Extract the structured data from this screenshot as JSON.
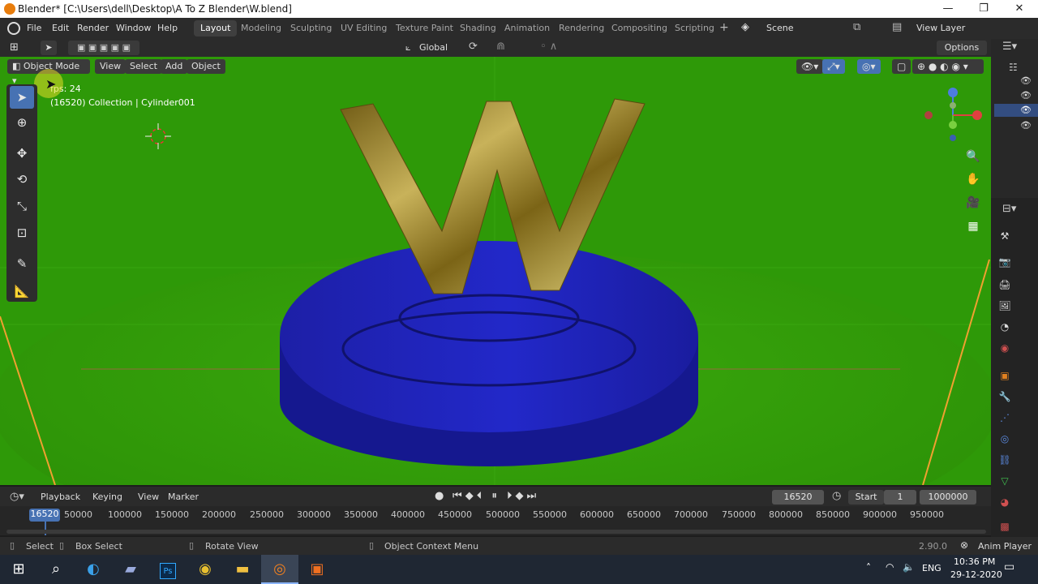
{
  "window": {
    "title": "Blender* [C:\\Users\\dell\\Desktop\\A To Z Blender\\W.blend]",
    "minimize": "—",
    "maximize": "❐",
    "close": "✕"
  },
  "menus": [
    "File",
    "Edit",
    "Render",
    "Window",
    "Help"
  ],
  "workspaces": [
    "Layout",
    "Modeling",
    "Sculpting",
    "UV Editing",
    "Texture Paint",
    "Shading",
    "Animation",
    "Rendering",
    "Compositing",
    "Scripting"
  ],
  "scene": {
    "name": "Scene",
    "view_layer": "View Layer"
  },
  "toolrow": {
    "orientation": "Global",
    "options": "Options"
  },
  "viewport": {
    "mode": "Object Mode",
    "menus": [
      "View",
      "Select",
      "Add",
      "Object"
    ],
    "fps_text": "fps: 24",
    "info": "(16520) Collection | Cylinder001",
    "letter": "W"
  },
  "colors": {
    "viewport_bg": "#2f9a08",
    "base": "#1b1fb8",
    "gold": "#a08a2a",
    "accent": "#4772b3"
  },
  "timeline": {
    "menus": [
      "Playback",
      "Keying",
      "View",
      "Marker"
    ],
    "current_frame": "16520",
    "start_label": "Start",
    "start": "1",
    "end": "1000000",
    "ticks": [
      "16520",
      "50000",
      "100000",
      "150000",
      "200000",
      "250000",
      "300000",
      "350000",
      "400000",
      "450000",
      "500000",
      "550000",
      "600000",
      "650000",
      "700000",
      "750000",
      "800000",
      "850000",
      "900000",
      "950000"
    ]
  },
  "status": {
    "select": "Select",
    "box_select": "Box Select",
    "rotate": "Rotate View",
    "context": "Object Context Menu",
    "version": "2.90.0",
    "anim_player": "Anim Player"
  },
  "taskbar": {
    "lang": "ENG",
    "time": "10:36 PM",
    "date": "29-12-2020"
  }
}
